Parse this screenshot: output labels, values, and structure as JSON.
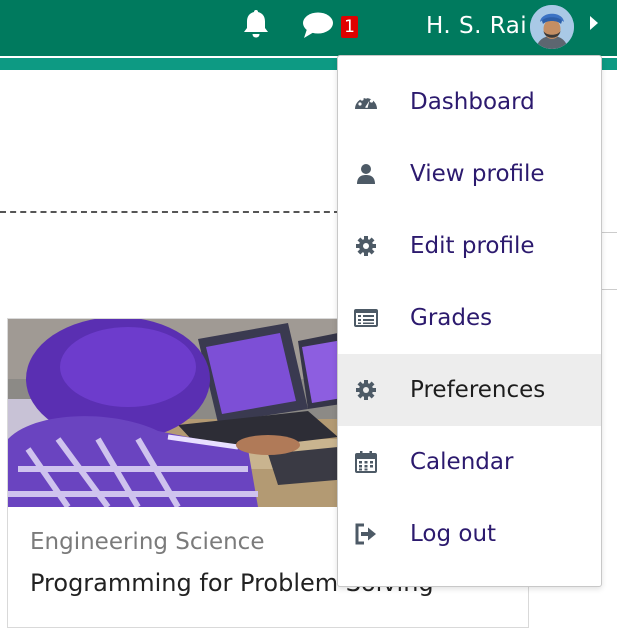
{
  "header": {
    "notification_count": "1",
    "user_name": "H. S. Rai"
  },
  "user_menu": {
    "items": [
      {
        "label": "Dashboard",
        "icon": "dashboard-icon"
      },
      {
        "label": "View profile",
        "icon": "user-icon"
      },
      {
        "label": "Edit profile",
        "icon": "cog-icon"
      },
      {
        "label": "Grades",
        "icon": "grades-table-icon"
      },
      {
        "label": "Preferences",
        "icon": "cog-icon",
        "active": true
      },
      {
        "label": "Calendar",
        "icon": "calendar-icon"
      },
      {
        "label": "Log out",
        "icon": "sign-out-icon"
      }
    ]
  },
  "course_card": {
    "category": "Engineering Science",
    "name": "Programming for Problem Solving"
  },
  "colors": {
    "navbar": "#007a5e",
    "navbar_stripe": "#0d9a83",
    "menu_link": "#2c1a6e",
    "menu_active_bg": "#ededed",
    "badge": "#e00000"
  }
}
